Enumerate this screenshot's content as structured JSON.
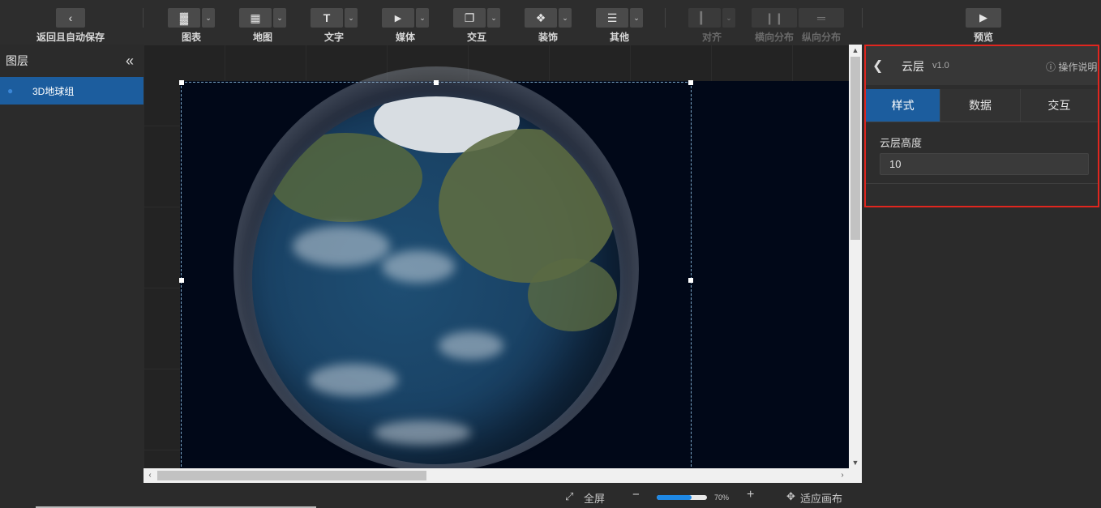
{
  "toolbar": {
    "back": {
      "icon": "chevron-left-icon",
      "label": "返回且自动保存"
    },
    "chart": {
      "label": "图表"
    },
    "map": {
      "label": "地图"
    },
    "text": {
      "label": "文字"
    },
    "media": {
      "label": "媒体"
    },
    "interact": {
      "label": "交互"
    },
    "decoration": {
      "label": "装饰"
    },
    "other": {
      "label": "其他"
    },
    "align": {
      "label": "对齐"
    },
    "h_distribute": {
      "label": "横向分布"
    },
    "v_distribute": {
      "label": "纵向分布"
    },
    "preview": {
      "label": "预览"
    }
  },
  "layers": {
    "title": "图层",
    "collapse_icon": "double-chevron-left-icon",
    "items": [
      {
        "label": "3D地球组",
        "selected": true
      }
    ]
  },
  "bottom_bar": {
    "fullscreen": "全屏",
    "zoom_minus": "−",
    "zoom_value": "70%",
    "zoom_fraction": 0.7,
    "zoom_plus": "+",
    "fit_canvas": "适应画布"
  },
  "properties": {
    "title": "云层",
    "version": "v1.0",
    "help": "ⓘ 操作说明",
    "tabs": [
      {
        "label": "样式",
        "active": true
      },
      {
        "label": "数据",
        "active": false
      },
      {
        "label": "交互",
        "active": false
      }
    ],
    "field": {
      "label": "云层高度",
      "value": "10"
    }
  },
  "colors": {
    "accent": "#1c5d9e",
    "highlight_border": "#e0261f",
    "canvas_bg": "#010818"
  }
}
